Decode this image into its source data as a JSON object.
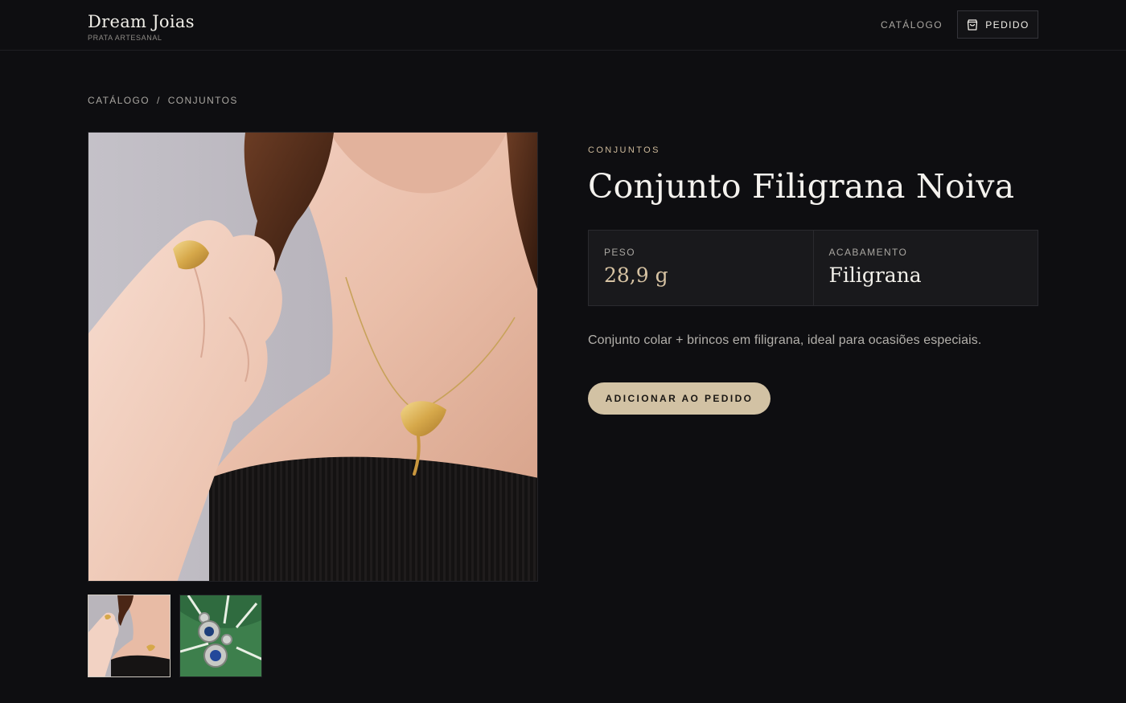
{
  "header": {
    "brand_name": "Dream Joias",
    "brand_tagline": "PRATA ARTESANAL",
    "nav_catalog": "CATÁLOGO",
    "order_button": "PEDIDO",
    "order_icon": "shopping-bag-icon"
  },
  "breadcrumb": {
    "items": [
      "CATÁLOGO",
      "CONJUNTOS"
    ],
    "separator": "/"
  },
  "gallery": {
    "main_image": "photo of woman wearing gold ginkgo leaf pendant necklace and ring",
    "thumbnails": [
      {
        "image": "necklace model photo",
        "selected": true
      },
      {
        "image": "blue gem filigree earrings on green leaf",
        "selected": false
      }
    ]
  },
  "product": {
    "category": "CONJUNTOS",
    "title": "Conjunto Filigrana Noiva",
    "specs": [
      {
        "label": "PESO",
        "value": "28,9 g"
      },
      {
        "label": "ACABAMENTO",
        "value": "Filigrana"
      }
    ],
    "description": "Conjunto colar + brincos em filigrana, ideal para ocasiões especiais.",
    "add_button": "ADICIONAR AO PEDIDO"
  },
  "colors": {
    "background": "#0e0e11",
    "accent_gold": "#d2c2a4",
    "category_gold": "#cdb99a",
    "text_primary": "#f1efe9",
    "text_muted": "#a9a6a1"
  }
}
